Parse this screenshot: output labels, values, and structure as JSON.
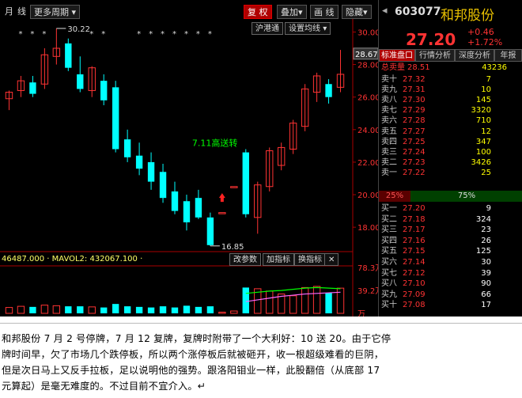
{
  "toolbar": {
    "period_month": "月",
    "period_week": "线",
    "more_period": "更多周期",
    "restore": "复 权",
    "overlay": "叠加",
    "draw_line": "画 线",
    "hide": "隐藏",
    "index_sub": "沪港通",
    "set_ma": "设置均线"
  },
  "chart": {
    "y_ticks": [
      "30.00",
      "28.00",
      "26.00",
      "24.00",
      "22.00",
      "20.00",
      "18.00"
    ],
    "current_price_label": "28.67",
    "high_label": "30.22",
    "low_label": "16.85",
    "annotation": "7.11高送转",
    "colors": {
      "up": "#ff3333",
      "down": "#00ffff",
      "bg": "#000000"
    }
  },
  "volume": {
    "mavol_text": "46487.000 · MAVOL2: 432067.100 ·",
    "buttons": [
      "改参数",
      "加指标",
      "换指标"
    ],
    "close_icon": "✕",
    "y_ticks": [
      "78.3万",
      "39.2万",
      "万"
    ]
  },
  "quote": {
    "code": "603077",
    "name": "和邦股份",
    "price": "27.20",
    "change": "+0.46",
    "change_pct": "+1.72%",
    "tabs": [
      "标准盘口",
      "行情分析",
      "深度分析",
      "年报"
    ],
    "total_sell_label": "总卖量",
    "total_sell_price": "28.51",
    "total_sell_volume": "43236",
    "sell": [
      {
        "label": "卖十",
        "price": "27.32",
        "vol": "7"
      },
      {
        "label": "卖九",
        "price": "27.31",
        "vol": "10"
      },
      {
        "label": "卖八",
        "price": "27.30",
        "vol": "145"
      },
      {
        "label": "卖七",
        "price": "27.29",
        "vol": "3320"
      },
      {
        "label": "卖六",
        "price": "27.28",
        "vol": "710"
      },
      {
        "label": "卖五",
        "price": "27.27",
        "vol": "12"
      },
      {
        "label": "卖四",
        "price": "27.25",
        "vol": "347"
      },
      {
        "label": "卖三",
        "price": "27.24",
        "vol": "100"
      },
      {
        "label": "卖二",
        "price": "27.23",
        "vol": "3426"
      },
      {
        "label": "卖一",
        "price": "27.22",
        "vol": "25"
      }
    ],
    "ratio_sell": "25%",
    "ratio_buy": "75%",
    "buy": [
      {
        "label": "买一",
        "price": "27.20",
        "vol": "9"
      },
      {
        "label": "买二",
        "price": "27.18",
        "vol": "324"
      },
      {
        "label": "买三",
        "price": "27.17",
        "vol": "23"
      },
      {
        "label": "买四",
        "price": "27.16",
        "vol": "26"
      },
      {
        "label": "买五",
        "price": "27.15",
        "vol": "125"
      },
      {
        "label": "买六",
        "price": "27.14",
        "vol": "30"
      },
      {
        "label": "买七",
        "price": "27.12",
        "vol": "39"
      },
      {
        "label": "买八",
        "price": "27.10",
        "vol": "90"
      },
      {
        "label": "买九",
        "price": "27.09",
        "vol": "66"
      },
      {
        "label": "买十",
        "price": "27.08",
        "vol": "17"
      }
    ]
  },
  "note": {
    "line1": "和邦股份 7 月 2 号停牌，7 月 12 复牌，复牌时附带了一个大利好：10 送 20。由于它停",
    "line2": "牌时间早，欠了市场几个跌停板，所以两个涨停板后就被砸开，收一根超级难看的巨阴，",
    "line3": "但是次日马上又反手拉板，足以说明他的强势。跟洛阳钼业一样，此股翻倍（从底部 17",
    "line4": "元算起）是毫无难度的。不过目前不宜介入。↵"
  },
  "chart_data": {
    "type": "candlestick",
    "y_range": [
      16.5,
      30.8
    ],
    "candles": [
      {
        "o": 25.9,
        "h": 26.4,
        "l": 25.2,
        "c": 26.3
      },
      {
        "o": 26.4,
        "h": 27.3,
        "l": 26.0,
        "c": 27.0
      },
      {
        "o": 26.9,
        "h": 27.3,
        "l": 26.0,
        "c": 26.2
      },
      {
        "o": 26.8,
        "h": 29.0,
        "l": 26.5,
        "c": 28.6
      },
      {
        "o": 28.5,
        "h": 30.22,
        "l": 28.0,
        "c": 29.0
      },
      {
        "o": 29.3,
        "h": 29.6,
        "l": 27.6,
        "c": 27.8
      },
      {
        "o": 27.4,
        "h": 28.5,
        "l": 26.3,
        "c": 26.5
      },
      {
        "o": 26.4,
        "h": 27.9,
        "l": 26.0,
        "c": 27.8
      },
      {
        "o": 27.0,
        "h": 27.4,
        "l": 25.5,
        "c": 25.8
      },
      {
        "o": 26.6,
        "h": 27.0,
        "l": 22.6,
        "c": 22.8
      },
      {
        "o": 23.4,
        "h": 24.0,
        "l": 22.0,
        "c": 22.3
      },
      {
        "o": 22.4,
        "h": 23.2,
        "l": 21.2,
        "c": 21.6
      },
      {
        "o": 22.0,
        "h": 22.6,
        "l": 20.3,
        "c": 20.8
      },
      {
        "o": 21.4,
        "h": 21.9,
        "l": 19.5,
        "c": 19.8
      },
      {
        "o": 20.2,
        "h": 20.8,
        "l": 18.8,
        "c": 19.0
      },
      {
        "o": 19.6,
        "h": 20.0,
        "l": 17.8,
        "c": 18.3
      },
      {
        "o": 19.8,
        "h": 20.3,
        "l": 18.5,
        "c": 18.6
      },
      {
        "o": 18.6,
        "h": 18.9,
        "l": 16.85,
        "c": 16.9
      },
      {
        "o": 18.9,
        "h": 18.9,
        "l": 18.9,
        "c": 18.9
      },
      {
        "o": 20.5,
        "h": 20.5,
        "l": 20.5,
        "c": 20.5
      },
      {
        "o": 22.6,
        "h": 22.8,
        "l": 18.6,
        "c": 18.8
      },
      {
        "o": 18.6,
        "h": 20.8,
        "l": 17.6,
        "c": 20.6
      },
      {
        "o": 20.5,
        "h": 22.9,
        "l": 20.2,
        "c": 22.7
      },
      {
        "o": 21.8,
        "h": 23.2,
        "l": 21.5,
        "c": 22.9
      },
      {
        "o": 22.8,
        "h": 24.6,
        "l": 22.5,
        "c": 24.4
      },
      {
        "o": 24.2,
        "h": 26.8,
        "l": 23.9,
        "c": 26.5
      },
      {
        "o": 26.3,
        "h": 27.5,
        "l": 25.7,
        "c": 27.3
      },
      {
        "o": 26.8,
        "h": 27.1,
        "l": 25.6,
        "c": 26.0
      },
      {
        "o": 26.6,
        "h": 28.9,
        "l": 26.3,
        "c": 27.4
      }
    ],
    "volume_range": [
      0,
      78.3
    ],
    "volume": [
      {
        "v": 10,
        "up": true
      },
      {
        "v": 12,
        "up": true
      },
      {
        "v": 11,
        "up": false
      },
      {
        "v": 14,
        "up": true
      },
      {
        "v": 13,
        "up": true
      },
      {
        "v": 12,
        "up": false
      },
      {
        "v": 12,
        "up": false
      },
      {
        "v": 11,
        "up": true
      },
      {
        "v": 10,
        "up": false
      },
      {
        "v": 16,
        "up": false
      },
      {
        "v": 12,
        "up": false
      },
      {
        "v": 11,
        "up": false
      },
      {
        "v": 10,
        "up": false
      },
      {
        "v": 12,
        "up": false
      },
      {
        "v": 10,
        "up": false
      },
      {
        "v": 13,
        "up": false
      },
      {
        "v": 11,
        "up": false
      },
      {
        "v": 12,
        "up": false
      },
      {
        "v": 2,
        "up": true
      },
      {
        "v": 4,
        "up": true
      },
      {
        "v": 44,
        "up": false
      },
      {
        "v": 42,
        "up": true
      },
      {
        "v": 38,
        "up": true
      },
      {
        "v": 33,
        "up": true
      },
      {
        "v": 30,
        "up": true
      },
      {
        "v": 44,
        "up": true
      },
      {
        "v": 46,
        "up": true
      },
      {
        "v": 35,
        "up": false
      },
      {
        "v": 43,
        "up": true
      }
    ],
    "ma_line": [
      34,
      36,
      38,
      39,
      41,
      43,
      44,
      43,
      42
    ],
    "ma_line2": [
      20,
      23,
      26,
      29,
      31,
      33,
      34,
      35,
      36
    ]
  }
}
